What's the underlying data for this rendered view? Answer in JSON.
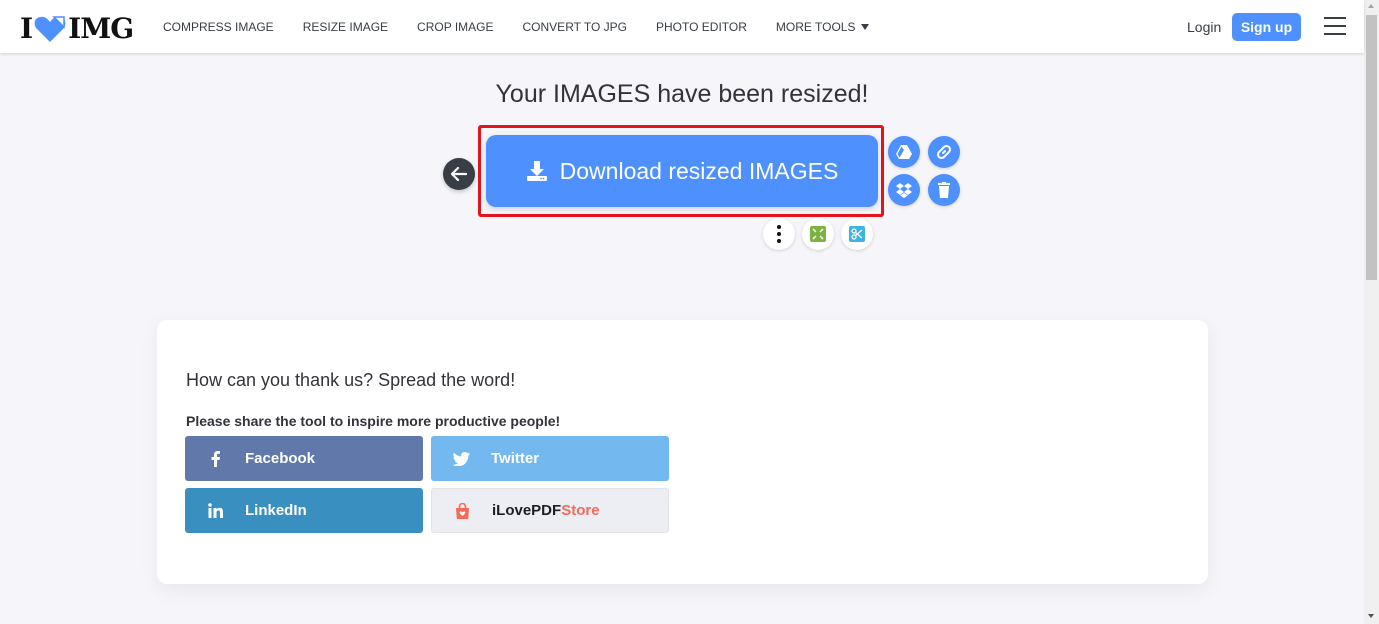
{
  "header": {
    "logo": {
      "left": "I",
      "right": "IMG",
      "icon": "heart-icon"
    },
    "nav": [
      {
        "label": "COMPRESS IMAGE"
      },
      {
        "label": "RESIZE IMAGE"
      },
      {
        "label": "CROP IMAGE"
      },
      {
        "label": "CONVERT TO JPG"
      },
      {
        "label": "PHOTO EDITOR"
      },
      {
        "label": "MORE TOOLS"
      }
    ],
    "login_label": "Login",
    "signup_label": "Sign up"
  },
  "main": {
    "title": "Your IMAGES have been resized!",
    "download_label": "Download resized IMAGES",
    "side_actions": [
      {
        "icon": "google-drive-icon"
      },
      {
        "icon": "link-icon"
      },
      {
        "icon": "dropbox-icon"
      },
      {
        "icon": "trash-icon"
      }
    ],
    "mini_actions": [
      {
        "icon": "more-vertical-icon"
      },
      {
        "icon": "compress-tool-icon"
      },
      {
        "icon": "crop-tool-icon"
      }
    ]
  },
  "share_card": {
    "heading": "How can you thank us? Spread the word!",
    "subheading": "Please share the tool to inspire more productive people!",
    "buttons": [
      {
        "label": "Facebook",
        "color": "#6178ab"
      },
      {
        "label": "Twitter",
        "color": "#73b9ef"
      },
      {
        "label": "LinkedIn",
        "color": "#3a8fc1"
      },
      {
        "label_black": "iLovePDF",
        "label_red": "Store",
        "color": "#ededf4"
      }
    ]
  },
  "colors": {
    "accent": "#4d90fe",
    "highlight": "#e5131a",
    "background": "#f5f5fa"
  }
}
